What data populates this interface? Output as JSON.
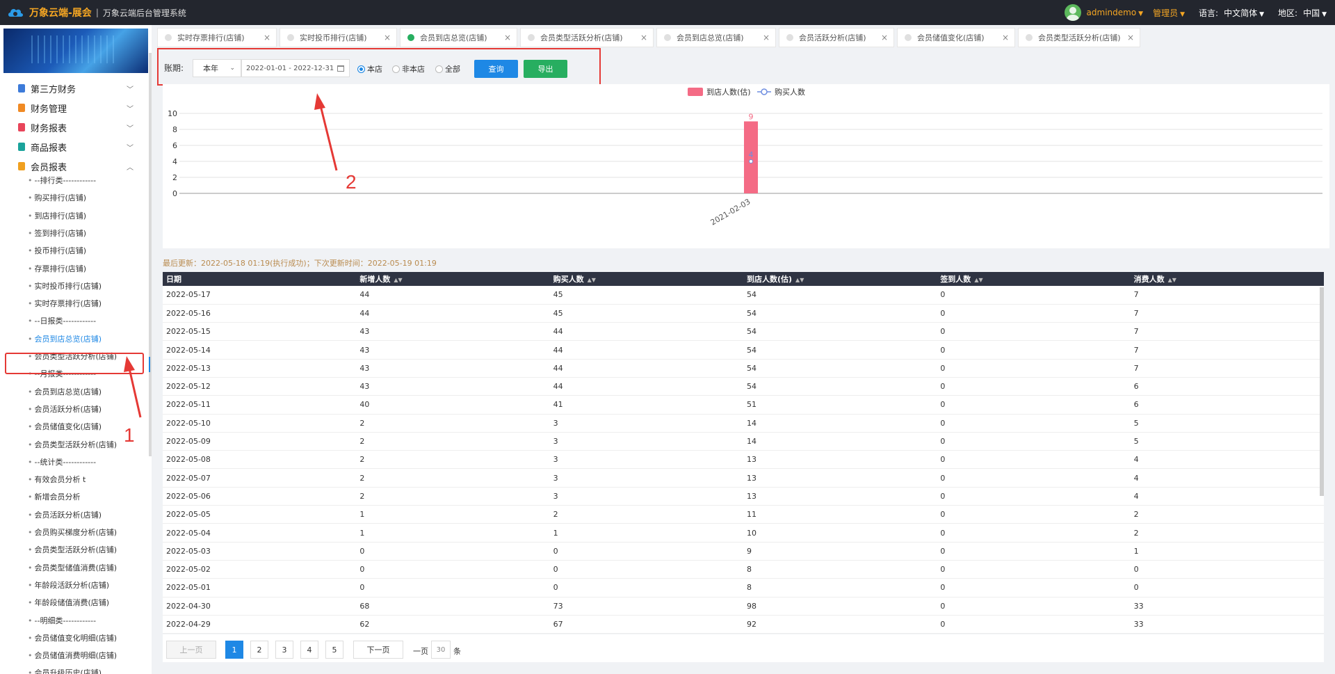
{
  "app": {
    "title": "万象云端-展会",
    "separator": "|",
    "subtitle": "万象云端后台管理系统"
  },
  "topbar": {
    "user": "admindemo",
    "role": "管理员",
    "language_label": "语言:",
    "language_value": "中文简体",
    "region_label": "地区:",
    "region_value": "中国"
  },
  "sidebar": {
    "groups": [
      {
        "label": "第三方财务",
        "icon": "calculator-icon",
        "color": "#3d7bd9"
      },
      {
        "label": "财务管理",
        "icon": "ledger-icon",
        "color": "#f08a24"
      },
      {
        "label": "财务报表",
        "icon": "report-icon",
        "color": "#e8455a"
      },
      {
        "label": "商品报表",
        "icon": "goods-icon",
        "color": "#1aa39b"
      },
      {
        "label": "会员报表",
        "icon": "member-icon",
        "color": "#f0a020"
      }
    ],
    "items": [
      "--排行类------------",
      "购买排行(店铺)",
      "到店排行(店铺)",
      "签到排行(店铺)",
      "投币排行(店铺)",
      "存票排行(店铺)",
      "实时投币排行(店铺)",
      "实时存票排行(店铺)",
      "--日报类------------",
      "会员到店总览(店铺)",
      "会员类型活跃分析(店铺)",
      "--月报类------------",
      "会员到店总览(店铺)",
      "会员活跃分析(店铺)",
      "会员储值变化(店铺)",
      "会员类型活跃分析(店铺)",
      "--统计类------------",
      "有效会员分析 t",
      "新增会员分析",
      "会员活跃分析(店铺)",
      "会员购买梯度分析(店铺)",
      "会员类型活跃分析(店铺)",
      "会员类型储值消费(店铺)",
      "年龄段活跃分析(店铺)",
      "年龄段储值消费(店铺)",
      "--明细类------------",
      "会员储值变化明细(店铺)",
      "会员储值消费明细(店铺)",
      "会员升级历史(店铺)"
    ],
    "active_index": 9
  },
  "tabs": [
    {
      "label": "实时存票排行(店铺)",
      "active": false
    },
    {
      "label": "实时投币排行(店铺)",
      "active": false
    },
    {
      "label": "会员到店总览(店铺)",
      "active": true
    },
    {
      "label": "会员类型活跃分析(店铺)",
      "active": false
    },
    {
      "label": "会员到店总览(店铺)",
      "active": false
    },
    {
      "label": "会员活跃分析(店铺)",
      "active": false
    },
    {
      "label": "会员储值变化(店铺)",
      "active": false
    },
    {
      "label": "会员类型活跃分析(店铺)",
      "active": false
    }
  ],
  "filter": {
    "label": "账期:",
    "period": "本年",
    "date_range": "2022-01-01 - 2022-12-31",
    "radios": [
      {
        "label": "本店",
        "checked": true
      },
      {
        "label": "非本店",
        "checked": false
      },
      {
        "label": "全部",
        "checked": false
      }
    ],
    "query_label": "查询",
    "export_label": "导出"
  },
  "chart_data": {
    "type": "bar",
    "categories": [
      "2021-02-03"
    ],
    "series": [
      {
        "name": "到店人数(估)",
        "type": "bar",
        "values": [
          9
        ],
        "color": "#f46b85"
      },
      {
        "name": "购买人数",
        "type": "line",
        "values": [
          4
        ],
        "color": "#6f8ee0"
      }
    ],
    "ylim": [
      0,
      10
    ],
    "yticks": [
      0,
      2,
      4,
      6,
      8,
      10
    ],
    "grid": true,
    "legend": "top-center"
  },
  "update_info": "最后更新：2022-05-18 01:19(执行成功)；下次更新时间：2022-05-19 01:19",
  "table": {
    "columns": [
      "日期",
      "新增人数",
      "购买人数",
      "到店人数(估)",
      "签到人数",
      "消费人数"
    ],
    "rows": [
      [
        "2022-05-17",
        "44",
        "45",
        "54",
        "0",
        "7"
      ],
      [
        "2022-05-16",
        "44",
        "45",
        "54",
        "0",
        "7"
      ],
      [
        "2022-05-15",
        "43",
        "44",
        "54",
        "0",
        "7"
      ],
      [
        "2022-05-14",
        "43",
        "44",
        "54",
        "0",
        "7"
      ],
      [
        "2022-05-13",
        "43",
        "44",
        "54",
        "0",
        "7"
      ],
      [
        "2022-05-12",
        "43",
        "44",
        "54",
        "0",
        "6"
      ],
      [
        "2022-05-11",
        "40",
        "41",
        "51",
        "0",
        "6"
      ],
      [
        "2022-05-10",
        "2",
        "3",
        "14",
        "0",
        "5"
      ],
      [
        "2022-05-09",
        "2",
        "3",
        "14",
        "0",
        "5"
      ],
      [
        "2022-05-08",
        "2",
        "3",
        "13",
        "0",
        "4"
      ],
      [
        "2022-05-07",
        "2",
        "3",
        "13",
        "0",
        "4"
      ],
      [
        "2022-05-06",
        "2",
        "3",
        "13",
        "0",
        "4"
      ],
      [
        "2022-05-05",
        "1",
        "2",
        "11",
        "0",
        "2"
      ],
      [
        "2022-05-04",
        "1",
        "1",
        "10",
        "0",
        "2"
      ],
      [
        "2022-05-03",
        "0",
        "0",
        "9",
        "0",
        "1"
      ],
      [
        "2022-05-02",
        "0",
        "0",
        "8",
        "0",
        "0"
      ],
      [
        "2022-05-01",
        "0",
        "0",
        "8",
        "0",
        "0"
      ],
      [
        "2022-04-30",
        "68",
        "73",
        "98",
        "0",
        "33"
      ],
      [
        "2022-04-29",
        "62",
        "67",
        "92",
        "0",
        "33"
      ]
    ]
  },
  "pager": {
    "prev": "上一页",
    "pages": [
      "1",
      "2",
      "3",
      "4",
      "5"
    ],
    "current": "1",
    "next": "下一页",
    "per_page_label": "一页",
    "per_page": "30",
    "unit": "条"
  },
  "annotations": {
    "label_1": "1",
    "label_2": "2",
    "color": "#e53935"
  }
}
